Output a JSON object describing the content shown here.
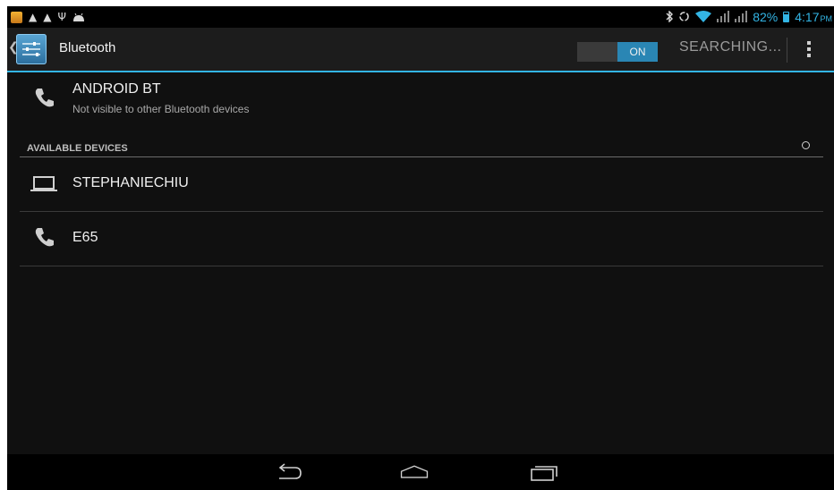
{
  "status_bar": {
    "battery_percent": "82%",
    "battery_level": 0.82,
    "time": "4:17",
    "ampm": "PM",
    "left_icons": [
      "app-notification-icon",
      "warning-icon",
      "warning-icon",
      "usb-icon",
      "android-debug-icon"
    ],
    "right_icons": [
      "bluetooth-icon",
      "sync-icon",
      "wifi-icon",
      "signal-icon",
      "signal-icon",
      "battery-icon"
    ]
  },
  "action_bar": {
    "title": "Bluetooth",
    "toggle_label": "ON",
    "action_label": "SEARCHING...",
    "icons": [
      "up-caret-icon",
      "settings-app-icon",
      "overflow-menu-icon"
    ]
  },
  "this_device": {
    "name": "ANDROID BT",
    "subtitle": "Not visible to other Bluetooth devices",
    "icon": "phone-icon"
  },
  "available_devices": {
    "header": "AVAILABLE DEVICES",
    "items": [
      {
        "name": "STEPHANIECHIU",
        "icon": "laptop-icon"
      },
      {
        "name": "E65",
        "icon": "phone-icon"
      }
    ]
  },
  "navigation": {
    "icons": [
      "back-icon",
      "home-icon",
      "recent-apps-icon"
    ]
  },
  "colors": {
    "accent": "#33b5e5",
    "toggle_on": "#2a86b4",
    "background": "#101010"
  }
}
